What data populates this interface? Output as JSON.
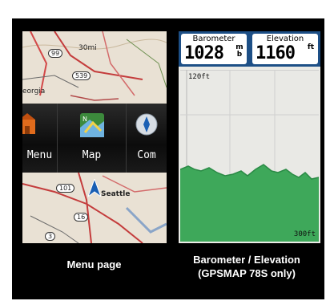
{
  "left_screen": {
    "map_labels": {
      "georgia": "eorgia",
      "seattle": "Seattle",
      "distance": "30mi"
    },
    "highway_shields": [
      "99",
      "539",
      "101",
      "16",
      "3"
    ],
    "menu_items": [
      {
        "label": "Menu",
        "icon": "home-icon"
      },
      {
        "label": "Map",
        "icon": "map-icon"
      },
      {
        "label": "Com",
        "icon": "compass-icon"
      }
    ]
  },
  "right_screen": {
    "barometer": {
      "title": "Barometer",
      "value": "1028",
      "unit": "mb"
    },
    "elevation": {
      "title": "Elevation",
      "value": "1160",
      "unit": "ft"
    },
    "axis_top": "120ft",
    "axis_bottom": "300ft",
    "colors": {
      "header": "#1d4f86",
      "fill": "#3ea85a"
    }
  },
  "captions": {
    "left": "Menu page",
    "right_line1": "Barometer / Elevation",
    "right_line2": "(GPSMAP 78S only)"
  }
}
